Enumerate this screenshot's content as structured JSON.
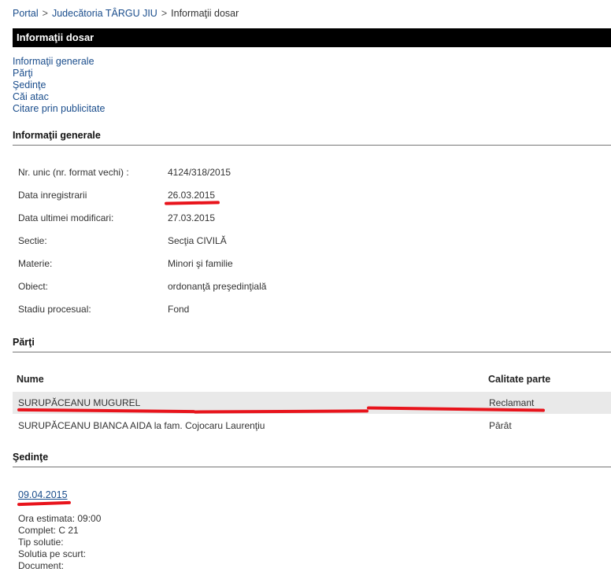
{
  "breadcrumb": {
    "portal": "Portal",
    "separator": ">",
    "court": "Judecătoria TÂRGU JIU",
    "current": "Informaţii dosar"
  },
  "title": "Informaţii dosar",
  "nav_links": [
    "Informaţii generale",
    "Părţi",
    "Şedinţe",
    "Căi atac",
    "Citare prin publicitate"
  ],
  "general": {
    "heading": "Informaţii generale",
    "rows": [
      {
        "label": "Nr. unic (nr. format vechi) :",
        "value": "4124/318/2015"
      },
      {
        "label": "Data inregistrarii",
        "value": "26.03.2015"
      },
      {
        "label": "Data ultimei modificari:",
        "value": "27.03.2015"
      },
      {
        "label": "Sectie:",
        "value": "Secţia CIVILĂ"
      },
      {
        "label": "Materie:",
        "value": "Minori şi familie"
      },
      {
        "label": "Obiect:",
        "value": "ordonanţă preşedinţială"
      },
      {
        "label": "Stadiu procesual:",
        "value": "Fond"
      }
    ]
  },
  "parties": {
    "heading": "Părţi",
    "columns": {
      "name": "Nume",
      "role": "Calitate parte"
    },
    "rows": [
      {
        "name": "SURUPĂCEANU MUGUREL",
        "role": "Reclamant"
      },
      {
        "name": "SURUPĂCEANU BIANCA AIDA la fam. Cojocaru Laurenţiu",
        "role": "Pârât"
      }
    ]
  },
  "hearings": {
    "heading": "Şedinţe",
    "date": "09.04.2015",
    "details": [
      "Ora estimata: 09:00",
      "Complet: C 21",
      "Tip solutie:",
      "Solutia pe scurt:",
      "Document:"
    ]
  },
  "colors": {
    "annotation": "#e8141c",
    "link": "#1a4d8c",
    "title_bar": "#000000"
  }
}
